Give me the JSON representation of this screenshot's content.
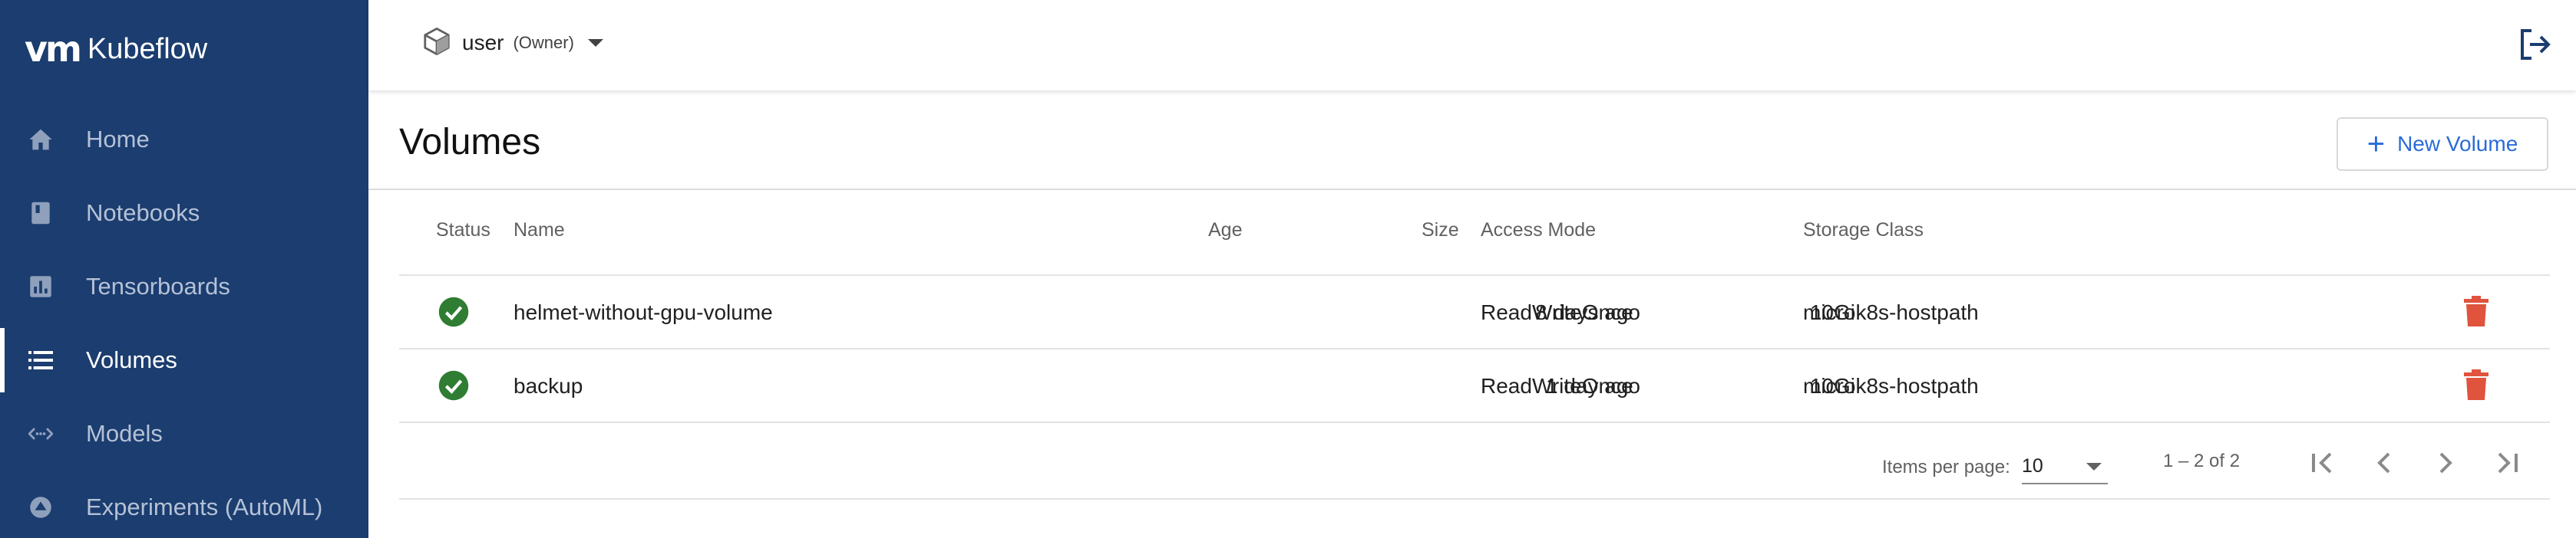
{
  "app": {
    "logo_mark": "vm",
    "name": "Kubeflow"
  },
  "sidebar": {
    "items": [
      {
        "label": "Home",
        "icon": "home-icon"
      },
      {
        "label": "Notebooks",
        "icon": "notebook-icon"
      },
      {
        "label": "Tensorboards",
        "icon": "chart-icon"
      },
      {
        "label": "Volumes",
        "icon": "storage-icon",
        "active": true
      },
      {
        "label": "Models",
        "icon": "code-arrows-icon"
      },
      {
        "label": "Experiments (AutoML)",
        "icon": "automl-icon"
      }
    ]
  },
  "topbar": {
    "namespace": "user",
    "role": "(Owner)"
  },
  "page": {
    "title": "Volumes",
    "new_button": "New Volume"
  },
  "table": {
    "headers": {
      "status": "Status",
      "name": "Name",
      "age": "Age",
      "size": "Size",
      "access_mode": "Access Mode",
      "storage_class": "Storage Class"
    },
    "rows": [
      {
        "status": "ready",
        "name": "helmet-without-gpu-volume",
        "age": "8 days ago",
        "size": "10Gi",
        "access_mode": "ReadWriteOnce",
        "storage_class": "microk8s-hostpath"
      },
      {
        "status": "ready",
        "name": "backup",
        "age": "1 day ago",
        "size": "10Gi",
        "access_mode": "ReadWriteOnce",
        "storage_class": "microk8s-hostpath"
      }
    ]
  },
  "paginator": {
    "items_per_page_label": "Items per page:",
    "page_size": "10",
    "range": "1 – 2 of 2"
  },
  "colors": {
    "sidebar_bg": "#1b3d6f",
    "accent": "#2a6bd8",
    "status_ok": "#2e7d32",
    "delete": "#e0533d"
  }
}
